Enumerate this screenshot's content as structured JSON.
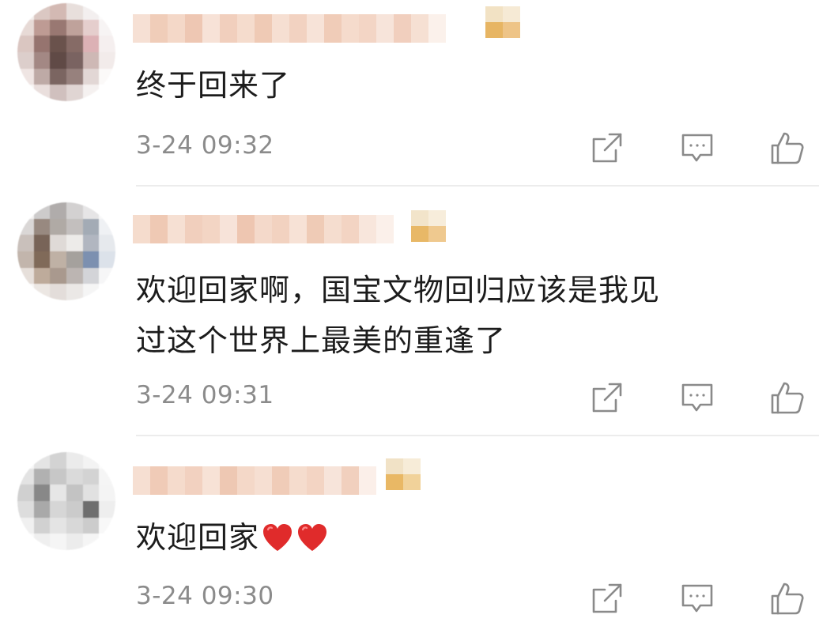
{
  "comments": [
    {
      "text": "终于回来了",
      "time": "3-24 09:32",
      "hearts": 0
    },
    {
      "text_line1": "欢迎回家啊，国宝文物回归应该是我见",
      "text_line2": "过这个世界上最美的重逢了",
      "time": "3-24 09:31",
      "hearts": 0
    },
    {
      "text": "欢迎回家",
      "time": "3-24 09:30",
      "hearts": 2
    }
  ],
  "icons": {
    "share": "share-icon",
    "comment": "comment-icon",
    "like": "thumbs-up-icon",
    "heart": "red-heart-icon"
  },
  "colors": {
    "text": "#1c1c1c",
    "time": "#8b8b8b",
    "icon": "#8a8a8a",
    "heart": "#e02b2b",
    "divider": "#ececec",
    "username_mosaic": "#f1cbb6",
    "badge": "#e8b45c"
  }
}
